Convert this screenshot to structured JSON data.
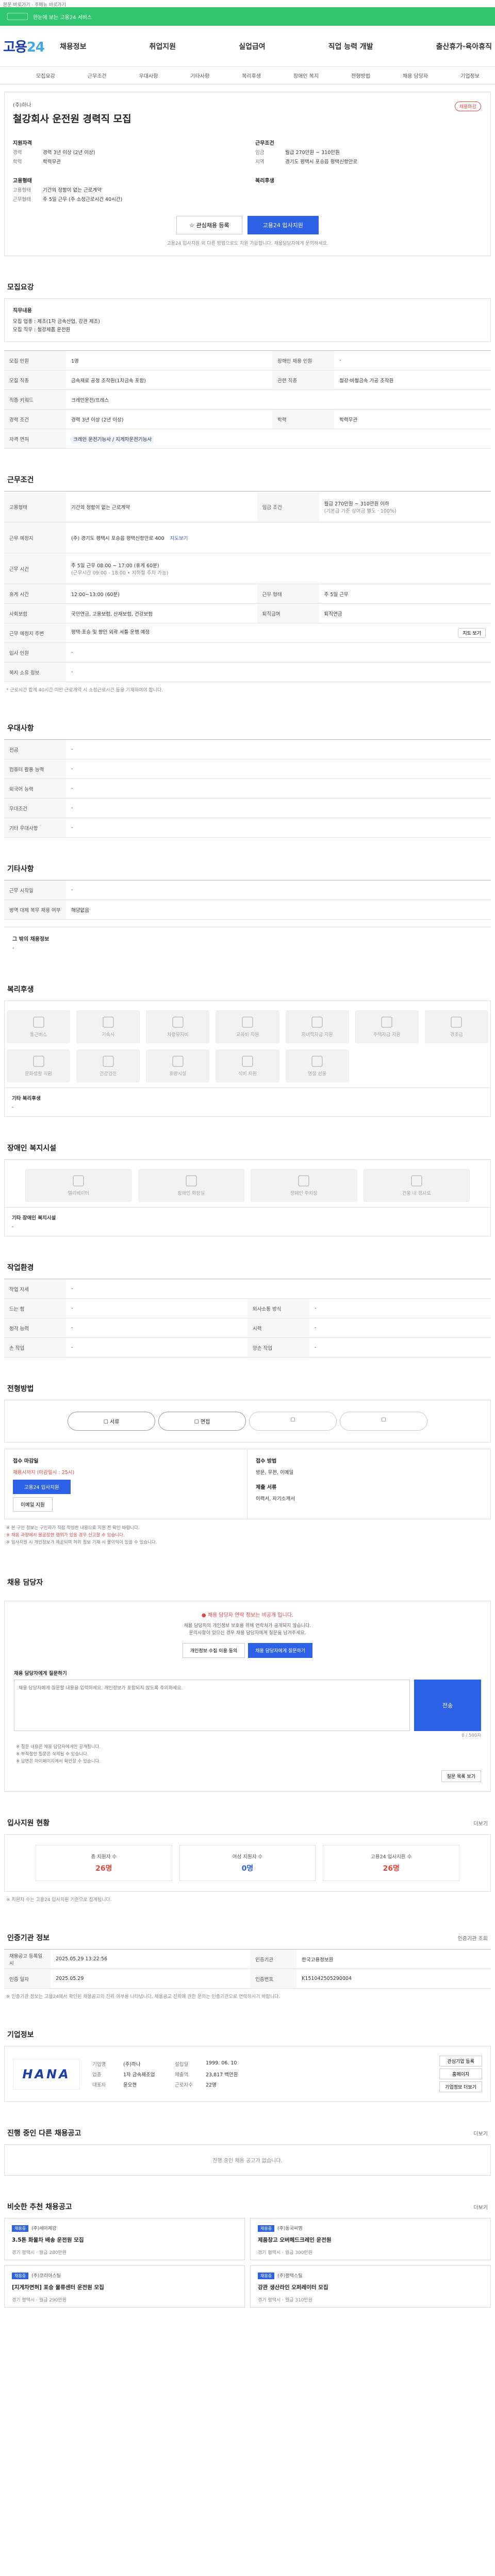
{
  "skip": "본문 바로가기 · 주메뉴 바로가기",
  "top": {
    "text": "한눈에 보는 고용24 서비스"
  },
  "logo": {
    "main": "고용",
    "num": "24"
  },
  "gnb": [
    "채용정보",
    "취업지원",
    "실업급여",
    "직업 능력 개발",
    "출산휴가·육아휴직"
  ],
  "subtabs": [
    "모집요강",
    "근무조건",
    "우대사항",
    "기타사항",
    "복리후생",
    "장애인 복지",
    "전형방법",
    "채용 담당자",
    "기업정보"
  ],
  "hero": {
    "company": "(주)하나",
    "title": "철강회사 운전원 경력직 모집",
    "badge": "채용마감",
    "left_h": "지원자격",
    "left": [
      {
        "k": "경력",
        "v": "경력 3년 이상 (2년 이상)"
      },
      {
        "k": "학력",
        "v": "학력무관"
      }
    ],
    "left_h2": "고용형태",
    "left2": [
      {
        "k": "고용형태",
        "v": "기간의 정함이 없는 근로계약"
      },
      {
        "k": "근무형태",
        "v": "주 5일 근무 (주 소정근로시간 40시간)"
      }
    ],
    "right_h": "근무조건",
    "right": [
      {
        "k": "임금",
        "v": "월급 270만원 ~ 310만원"
      },
      {
        "k": "지역",
        "v": "경기도 평택시 포승읍 평택신항만로"
      }
    ],
    "right_h2": "복리후생",
    "btn_save": "관심채용 등록",
    "btn_apply": "고용24 입사지원",
    "note": "고용24 입사지원 외 다른 방법으로도 지원 가능합니다. 채용담당자에게 문의하세요."
  },
  "recruit": {
    "title": "모집요강",
    "box_h": "직무내용",
    "box_lines": [
      "모집 업종 : 제조(1차 금속산업, 강관 제조)",
      "모집 직무 : 철강제품 운전원"
    ],
    "rows": [
      [
        "모집 인원",
        "1명",
        "장애인 채용 인원",
        "-"
      ],
      [
        "모집 직종",
        "금속재료 공정 조작원(1차금속 포함)",
        "관련 직종",
        "철강·비철금속 가공 조작원"
      ],
      [
        "직종 키워드",
        "크레인운전/프레스",
        "",
        ""
      ],
      [
        "경력 조건",
        "경력 3년 이상 (2년 이상)",
        "학력",
        "학력무관"
      ],
      [
        "자격 면허",
        "크레인 운전기능사 / 지게차운전기능사",
        "",
        ""
      ]
    ]
  },
  "work": {
    "title": "근무조건",
    "emp": "고용형태",
    "emp_v": "기간의 정함이 없는 근로계약",
    "wage": "임금 조건",
    "wage_v": "월급 270만원 ~ 310만원 이하",
    "wage_sub": "(기본급 기준 상여금 별도 · 100%)",
    "addr": "근무 예정지",
    "addr_v": "(주) 경기도 평택시 포승읍 평택신항만로 400",
    "addr_link": "지도보기",
    "time": "근무 시간",
    "time_v": "주 5일 근무 08:00 ~ 17:00 (휴게 60분)",
    "time2": "(근무시간 09:00 - 18:00 • 지하철 주차 가능)",
    "hour": "휴게 시간",
    "hour_v": "12:00~13:00 (60분)",
    "days": "근무 형태",
    "days_v": "주 5일 근무",
    "ins": "사회보험",
    "ins_v": "국민연금, 고용보험, 산재보험, 건강보험",
    "pension": "퇴직급여",
    "pension_v": "퇴직연금",
    "near": "근무 예정지 주변",
    "near_v": "평택·포승 및 항만 외곽 셔틀 운행 예정",
    "near_btn": "지도 보기",
    "house": "입사 인원",
    "house_v": "-",
    "meal": "복지 소유 정보",
    "meal_v": "-",
    "note": "* 근로시간 합계 40시간 미만 근로계약 시 소정근로시간 등을 기재하여야 합니다."
  },
  "pref": {
    "title": "우대사항",
    "rows": [
      [
        "전공",
        "-"
      ],
      [
        "컴퓨터 활용 능력",
        "-"
      ],
      [
        "외국어 능력",
        "-"
      ],
      [
        "우대조건",
        "-"
      ],
      [
        "기타 우대사항",
        "-"
      ]
    ]
  },
  "etc": {
    "title": "기타사항",
    "rows": [
      [
        "근무 시작일",
        "-"
      ],
      [
        "병역 대체 복무 채용 여부",
        "해당없음"
      ]
    ],
    "sub": "그 밖의 채용정보",
    "sub_v": "-"
  },
  "welfare": {
    "title": "복리후생",
    "items": [
      "통근버스",
      "기숙사",
      "차량유지비",
      "교육비 지원",
      "자녀학자금 지원",
      "주택자금 지원",
      "경조금",
      "문화생활 지원",
      "건강검진",
      "휴양시설",
      "식비 지원",
      "명절 선물"
    ],
    "other_h": "기타 복리후생",
    "other_v": "-"
  },
  "disab": {
    "title": "장애인 복지시설",
    "items": [
      "엘리베이터",
      "장애인 화장실",
      "장애인 주차장",
      "건물 내 경사로"
    ],
    "other_h": "기타 장애인 복지시설",
    "other_v": "-"
  },
  "work_env": {
    "title": "작업환경",
    "rows": [
      [
        "작업 자세",
        "-",
        "",
        ""
      ],
      [
        "드는 힘",
        "-",
        "의사소통 방식",
        "-"
      ],
      [
        "청각 능력",
        "-",
        "시력",
        "-"
      ],
      [
        "손 작업",
        "-",
        "양손 작업",
        "-"
      ]
    ]
  },
  "process": {
    "title": "전형방법",
    "steps": [
      "서류",
      "면접",
      "",
      ""
    ],
    "apply_h": "접수 마감일",
    "deadline": "채용시까지 (마감일시 : 25시)",
    "apply_btn": "고용24 입사지원",
    "apply_btn2": "이메일 지원",
    "method_h": "접수 방법",
    "method": "방문, 우편, 이메일",
    "docs_h": "제출 서류",
    "docs": "이력서, 자기소개서"
  },
  "notes": [
    "※ 본 구인 정보는 구인자가 직접 작성한 내용으로 지원 전 확인 바랍니다.",
    "※ 채용 과정에서 불공정한 행위가 있을 경우 신고할 수 있습니다.",
    "※ 입사지원 시 개인정보가 제공되며 허위 정보 기재 시 불이익이 있을 수 있습니다."
  ],
  "qa": {
    "title": "채용 담당자",
    "warn": "채용 담당자 연락 정보는 비공개 입니다.",
    "desc1": "채용 담당자의 개인정보 보호를 위해 연락처가 공개되지 않습니다.",
    "desc2": "문의사항이 있으신 경우 채용 담당자에게 질문을 남겨주세요.",
    "btn1": "개인정보 수집 이용 동의",
    "btn2": "채용 담당자에게 질문하기",
    "sub": "채용 담당자에게 질문하기",
    "sub_right": "",
    "placeholder": "채용 담당자에게 질문할 내용을 입력하세요. 개인정보가 포함되지 않도록 주의하세요.",
    "send": "전송",
    "count": "0 / 500자",
    "notes": [
      "※ 질문 내용은 채용 담당자에게만 공개됩니다.",
      "※ 부적절한 질문은 삭제될 수 있습니다.",
      "※ 답변은 마이페이지에서 확인할 수 있습니다."
    ],
    "notes_btn": "질문 목록 보기"
  },
  "stats": {
    "title": "입사지원 현황",
    "more": "더보기",
    "items": [
      {
        "lbl": "총 지원자 수",
        "val": "26명"
      },
      {
        "lbl": "여성 지원자 수",
        "val": "0명"
      },
      {
        "lbl": "고용24 입사지원 수",
        "val": "26명"
      }
    ],
    "note": "※ 지원자 수는 고용24 입사지원 기준으로 집계됩니다."
  },
  "info": {
    "title": "인증기관 정보",
    "more": "인증기관 조회",
    "rows": [
      [
        "채용공고 등록일시",
        "2025.05.29 13:22:56",
        "인증기관",
        "한국고용정보원"
      ],
      [
        "인증 일자",
        "2025.05.29",
        "인증번호",
        "K151042505290004"
      ]
    ],
    "note": "※ 인증기관 정보는 고용24에서 확인된 채용공고의 진위 여부를 나타냅니다. 채용공고 진위에 관한 문의는 인증기관으로 연락하시기 바랍니다."
  },
  "company": {
    "title": "기업정보",
    "logo": "HANA",
    "k1": "기업명",
    "v1": "(주)하나",
    "k2": "설립일",
    "v2": "1999. 06. 10",
    "k3": "업종",
    "v3": "1차 금속제조업",
    "k4": "매출액",
    "v4": "23,817 백만원",
    "k5": "대표자",
    "v5": "윤오현",
    "k6": "근로자수",
    "v6": "22명",
    "btn1": "관심기업 등록",
    "btn2": "홈페이지",
    "btn3": "기업정보 더보기"
  },
  "ongoing": {
    "title": "진행 중인 다른 채용공고",
    "more": "더보기",
    "empty": "진행 중인 채용 공고가 없습니다."
  },
  "similar": {
    "title": "비슷한 추천 채용공고",
    "more": "더보기",
    "jobs": [
      {
        "tag": "채용중",
        "company": "(주)세아제강",
        "title": "3.5톤 화물차 배송 운전원 모집",
        "meta": "경기 평택시 · 월급 280만원"
      },
      {
        "tag": "채용중",
        "company": "(주)동국씨엠",
        "title": "제품창고 오버헤드크레인 운전원",
        "meta": "경기 평택시 · 월급 300만원"
      },
      {
        "tag": "채용중",
        "company": "(주)코리아스틸",
        "title": "[지게차면허] 포승 물류센터 운전원 모집",
        "meta": "경기 평택시 · 월급 290만원"
      },
      {
        "tag": "채용중",
        "company": "(주)평택스틸",
        "title": "강관 생산라인 오퍼레이터 모집",
        "meta": "경기 평택시 · 월급 310만원"
      }
    ]
  }
}
